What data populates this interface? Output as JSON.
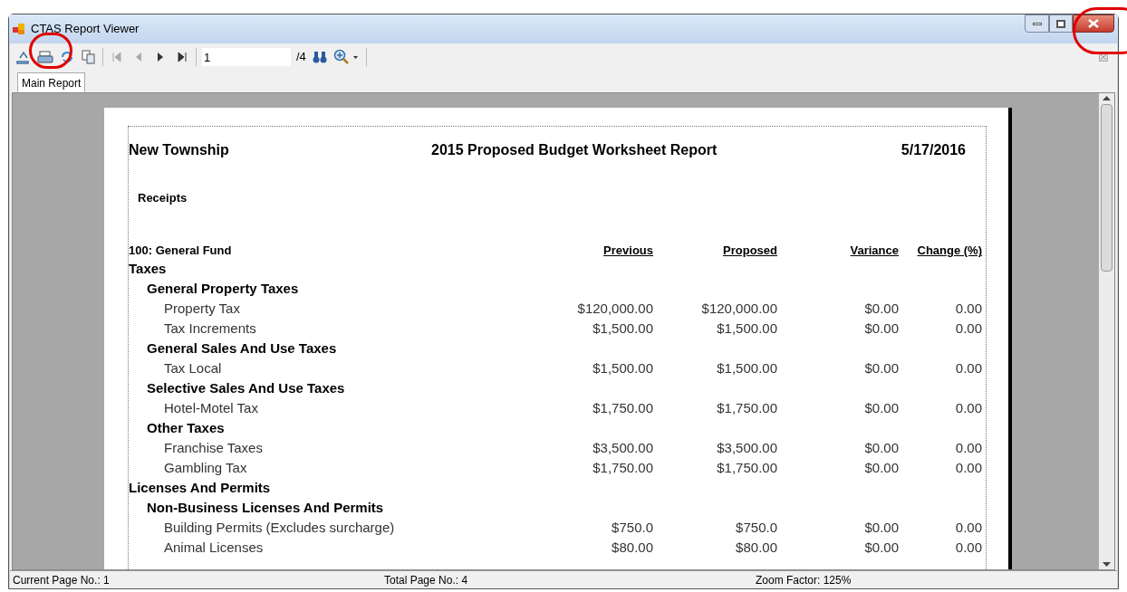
{
  "window": {
    "title": "CTAS Report Viewer"
  },
  "toolbar": {
    "page_input": "1",
    "page_total": "/4"
  },
  "tabs": [
    {
      "label": "Main Report",
      "selected": true
    }
  ],
  "report": {
    "entity": "New Township",
    "title": "2015 Proposed Budget Worksheet Report",
    "date": "5/17/2016",
    "section": "Receipts",
    "fund": "100: General Fund",
    "columns": [
      "Previous",
      "Proposed",
      "Variance",
      "Change (%)"
    ],
    "rows": [
      {
        "kind": "category",
        "label": "Taxes"
      },
      {
        "kind": "group",
        "label": "General Property Taxes"
      },
      {
        "kind": "item",
        "label": "Property Tax",
        "values": [
          "$120,000.00",
          "$120,000.00",
          "$0.00",
          "0.00"
        ]
      },
      {
        "kind": "item",
        "label": "Tax Increments",
        "values": [
          "$1,500.00",
          "$1,500.00",
          "$0.00",
          "0.00"
        ]
      },
      {
        "kind": "group",
        "label": "General Sales And Use Taxes"
      },
      {
        "kind": "item",
        "label": "Tax Local",
        "values": [
          "$1,500.00",
          "$1,500.00",
          "$0.00",
          "0.00"
        ]
      },
      {
        "kind": "group",
        "label": "Selective Sales And Use Taxes"
      },
      {
        "kind": "item",
        "label": "Hotel-Motel Tax",
        "values": [
          "$1,750.00",
          "$1,750.00",
          "$0.00",
          "0.00"
        ]
      },
      {
        "kind": "group",
        "label": "Other Taxes"
      },
      {
        "kind": "item",
        "label": "Franchise Taxes",
        "values": [
          "$3,500.00",
          "$3,500.00",
          "$0.00",
          "0.00"
        ]
      },
      {
        "kind": "item",
        "label": "Gambling Tax",
        "values": [
          "$1,750.00",
          "$1,750.00",
          "$0.00",
          "0.00"
        ]
      },
      {
        "kind": "category",
        "label": "Licenses And Permits"
      },
      {
        "kind": "group",
        "label": "Non-Business Licenses And Permits"
      },
      {
        "kind": "item",
        "label": "Building Permits (Excludes surcharge)",
        "values": [
          "$750.0",
          "$750.0",
          "$0.00",
          "0.00"
        ]
      },
      {
        "kind": "item",
        "label": "Animal Licenses",
        "values": [
          "$80.00",
          "$80.00",
          "$0.00",
          "0.00"
        ]
      }
    ]
  },
  "status_bar": [
    "Current Page No.: 1",
    "Total Page No.: 4",
    "Zoom Factor: 125%"
  ]
}
